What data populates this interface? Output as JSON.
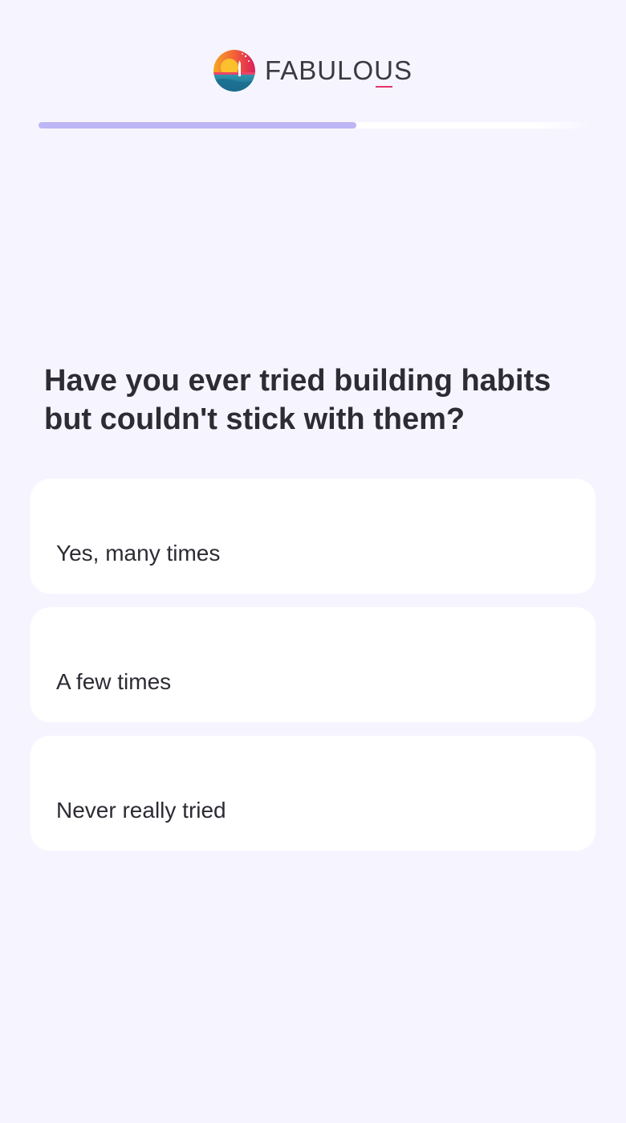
{
  "header": {
    "logo_icon": "fabulous-sunset-logo-icon",
    "brand_name_part1": "FABULO",
    "brand_name_u": "U",
    "brand_name_part2": "S"
  },
  "progress": {
    "value": 0.575
  },
  "question": {
    "text": "Have you ever tried building habits but couldn't stick with them?"
  },
  "options": [
    {
      "label": "Yes, many times"
    },
    {
      "label": "A few times"
    },
    {
      "label": "Never really tried"
    }
  ],
  "colors": {
    "background": "#f6f5ff",
    "progress_fill": "#bdb6f5",
    "card": "#ffffff",
    "text": "#2d2b33",
    "brand_underline": "#e5336d"
  }
}
